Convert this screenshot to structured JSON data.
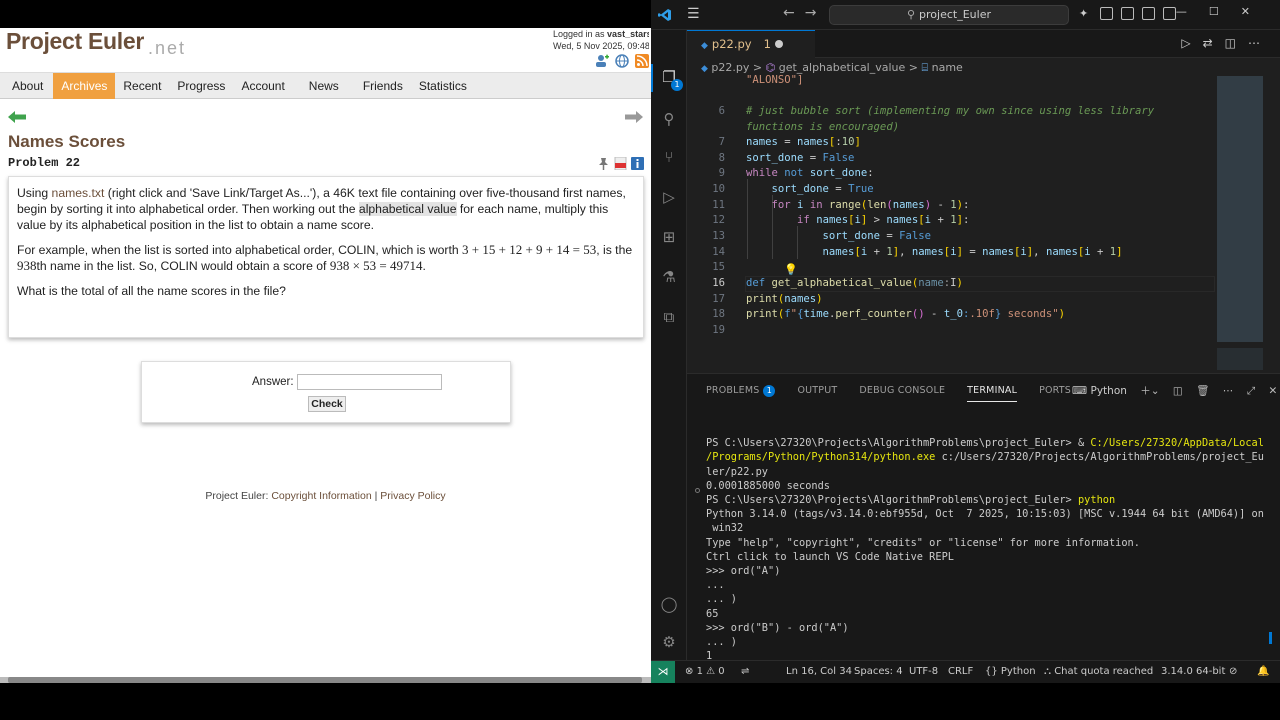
{
  "browser": {
    "logo": "Project Euler",
    "logo_suffix": ".net",
    "user": {
      "prefix": "Logged in as ",
      "name": "vast_stars",
      "date": "Wed, 5 Nov 2025, 09:48"
    },
    "nav": [
      "About",
      "Archives",
      "Recent",
      "Progress",
      "Account",
      "News",
      "Friends",
      "Statistics"
    ],
    "active_nav": "Archives",
    "problem_title": "Names Scores",
    "problem_number": "Problem 22",
    "p1": {
      "t1": "Using ",
      "link": "names.txt",
      "t2": " (right click and 'Save Link/Target As...'), a 46K text file containing over five-thousand first names, begin by sorting it into alphabetical order. Then working out the ",
      "hl": "alphabetical value",
      "t3": " for each name, multiply this value by its alphabetical position in the list to obtain a name score."
    },
    "p2": {
      "t1": "For example, when the list is sorted into alphabetical order, COLIN, which is worth ",
      "m1": "3 + 15 + 12 + 9 + 14 = 53",
      "t2": ", is the ",
      "m2": "938",
      "t3": "th name in the list. So, COLIN would obtain a score of ",
      "m3": "938 × 53 = 49714",
      "t4": "."
    },
    "p3": "What is the total of all the name scores in the file?",
    "answer_label": "Answer:",
    "answer_value": "",
    "check_label": "Check",
    "footer": {
      "prefix": "Project Euler: ",
      "link1": "Copyright Information",
      "sep": " | ",
      "link2": "Privacy Policy"
    },
    "colors": {
      "brand": "#6b4f3a",
      "active_tab": "#f0a040",
      "arrow": "#3fa34d"
    }
  },
  "vscode": {
    "search_text": "project_Euler",
    "tab": {
      "name": "p22.py",
      "problems": "1"
    },
    "breadcrumb": {
      "file": "p22.py",
      "sep": ">",
      "func": "get_alphabetical_value",
      "param": "name"
    },
    "activity_badge": "1",
    "code": {
      "top_partial": "\"ALONSO\"]",
      "l6": "# just bubble sort (implementing my own since using less library",
      "l6b": "functions is encouraged)",
      "ln": [
        "6",
        "7",
        "8",
        "9",
        "10",
        "11",
        "12",
        "13",
        "14",
        "15",
        "16",
        "17",
        "18",
        "19"
      ]
    },
    "panel_tabs": [
      "PROBLEMS",
      "OUTPUT",
      "DEBUG CONSOLE",
      "TERMINAL",
      "PORTS"
    ],
    "problems_count": "1",
    "terminal_shell": "Python",
    "terminal": [
      "PS C:\\Users\\27320\\Projects\\AlgorithmProblems\\project_Euler> & ",
      "C:/Users/27320/AppData/Local",
      "/Programs/Python/Python314/python.exe",
      " c:/Users/27320/Projects/AlgorithmProblems/project_Eu",
      "ler/p22.py",
      "0.0001885000 seconds",
      "PS C:\\Users\\27320\\Projects\\AlgorithmProblems\\project_Euler> ",
      "python",
      "Python 3.14.0 (tags/v3.14.0:ebf955d, Oct  7 2025, 10:15:03) [MSC v.1944 64 bit (AMD64)] on",
      " win32",
      "Type \"help\", \"copyright\", \"credits\" or \"license\" for more information.",
      "Ctrl click to launch VS Code Native REPL",
      ">>> ord(\"A\")",
      "...",
      "... )",
      "65",
      ">>> ord(\"B\") - ord(\"A\")",
      "... )",
      "1",
      ">>> "
    ],
    "status": {
      "errors": "1",
      "warnings": "0",
      "position": "Ln 16, Col 34",
      "spaces": "Spaces: 4",
      "encoding": "UTF-8",
      "eol": "CRLF",
      "language": "Python",
      "chat": "Chat quota reached",
      "version": "3.14.0 64-bit"
    }
  }
}
